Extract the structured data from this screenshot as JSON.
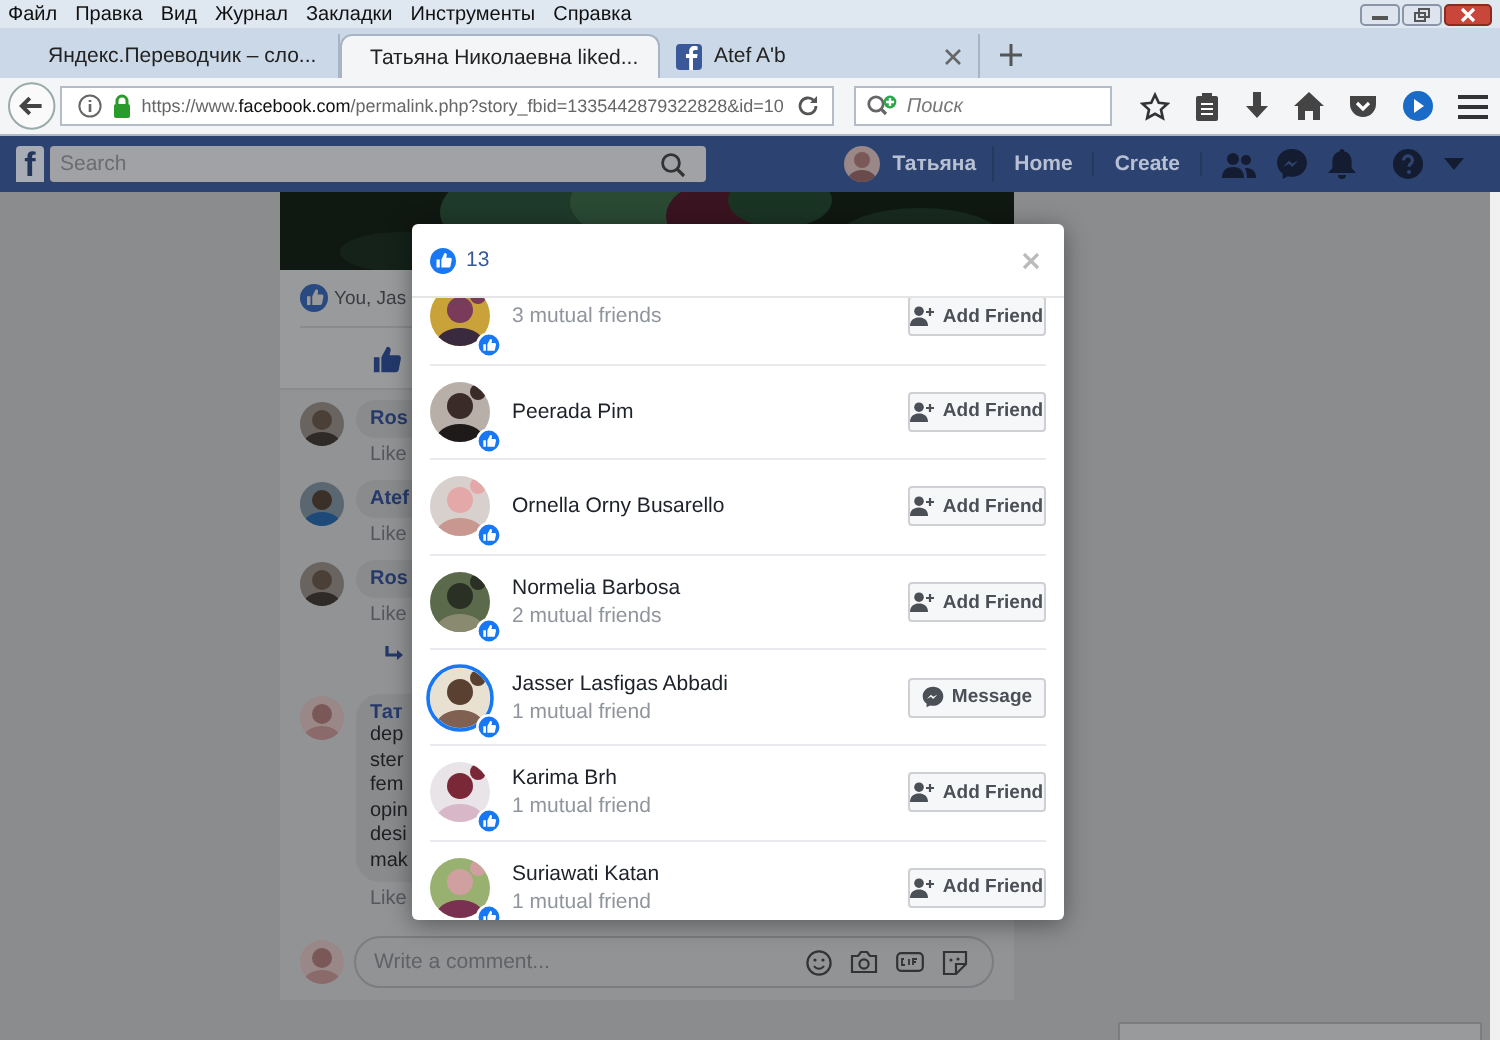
{
  "browser": {
    "menu": [
      "Файл",
      "Правка",
      "Вид",
      "Журнал",
      "Закладки",
      "Инструменты",
      "Справка"
    ],
    "tabs": [
      {
        "title": "Яндекс.Переводчик – сло...",
        "selected": false
      },
      {
        "title": "Татьяна Николаевна liked...",
        "selected": true
      },
      {
        "title": "Atef A'b",
        "selected": false
      }
    ],
    "address": {
      "prefix": "https://www.",
      "host": "facebook.com",
      "path": "/permalink.php?story_fbid=1335442879322828&id=10"
    },
    "search": {
      "placeholder": "Поиск"
    }
  },
  "facebook_bar": {
    "logo": "f",
    "search": {
      "placeholder": "Search"
    },
    "user": "Татьяна",
    "links": [
      "Home",
      "Create"
    ]
  },
  "post": {
    "likes_summary": "You, Jas",
    "comments": [
      {
        "author": "Ros",
        "action": "Like",
        "reply_thread": false
      },
      {
        "author": "Atef",
        "action": "Like",
        "reply_thread": false
      },
      {
        "author": "Ros",
        "action": "Like",
        "reply_thread": true
      },
      {
        "author": "Тат",
        "lines": [
          "dep",
          "ster",
          "fem",
          "opin",
          "desi",
          "mak"
        ],
        "action": "Like",
        "reply_thread": false
      }
    ],
    "composer": {
      "placeholder": "Write a comment..."
    }
  },
  "reactions_dialog": {
    "count": "13",
    "people": [
      {
        "mutual": "3 mutual friends",
        "ringed": false,
        "button": {
          "kind": "add_friend",
          "label": "Add Friend"
        }
      },
      {
        "name": "Peerada Pim",
        "ringed": false,
        "button": {
          "kind": "add_friend",
          "label": "Add Friend"
        }
      },
      {
        "name": "Ornella Orny Busarello",
        "ringed": false,
        "button": {
          "kind": "add_friend",
          "label": "Add Friend"
        }
      },
      {
        "name": "Normelia Barbosa",
        "mutual": "2 mutual friends",
        "ringed": false,
        "button": {
          "kind": "add_friend",
          "label": "Add Friend"
        }
      },
      {
        "name": "Jasser Lasfigas Abbadi",
        "mutual": "1 mutual friend",
        "ringed": true,
        "button": {
          "kind": "message",
          "label": "Message"
        }
      },
      {
        "name": "Karima Brh",
        "mutual": "1 mutual friend",
        "ringed": false,
        "button": {
          "kind": "add_friend",
          "label": "Add Friend"
        }
      },
      {
        "name": "Suriawati Katan",
        "mutual": "1 mutual friend",
        "ringed": false,
        "button": {
          "kind": "add_friend",
          "label": "Add Friend"
        }
      }
    ]
  }
}
